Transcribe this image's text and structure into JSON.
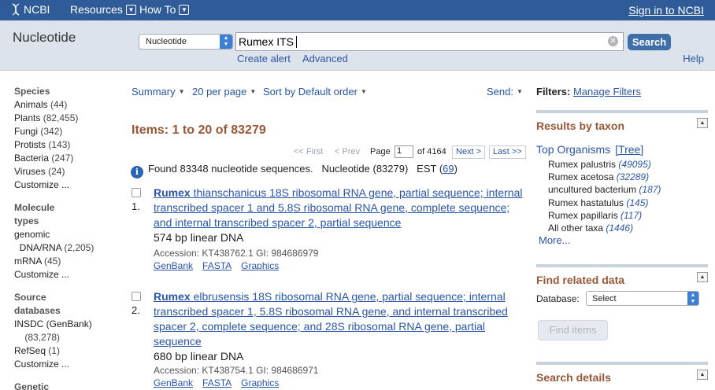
{
  "topbar": {
    "logo": "NCBI",
    "resources": "Resources",
    "howto": "How To",
    "signin": "Sign in to NCBI"
  },
  "search": {
    "db_title": "Nucleotide",
    "db_select": "Nucleotide",
    "term": "Rumex ITS",
    "button": "Search",
    "create_alert": "Create alert",
    "advanced": "Advanced",
    "help": "Help"
  },
  "facets": [
    {
      "header": "Species",
      "items": [
        {
          "label": "Animals",
          "count": "(44)"
        },
        {
          "label": "Plants",
          "count": "(82,455)"
        },
        {
          "label": "Fungi",
          "count": "(342)"
        },
        {
          "label": "Protists",
          "count": "(143)"
        },
        {
          "label": "Bacteria",
          "count": "(247)"
        },
        {
          "label": "Viruses",
          "count": "(24)"
        },
        {
          "label": "Customize ...",
          "count": ""
        }
      ]
    },
    {
      "header1": "Molecule",
      "header2": "types",
      "items": [
        {
          "label": "genomic",
          "label2": "DNA/RNA",
          "count": "(2,205)"
        },
        {
          "label": "mRNA",
          "count": "(45)"
        },
        {
          "label": "Customize ...",
          "count": ""
        }
      ]
    },
    {
      "header1": "Source",
      "header2": "databases",
      "items": [
        {
          "label": "INSDC (GenBank)",
          "label2": "",
          "count": "(83,278)"
        },
        {
          "label": "RefSeq",
          "count": "(1)"
        },
        {
          "label": "Customize ...",
          "count": ""
        }
      ]
    },
    {
      "header": "Genetic"
    }
  ],
  "toolbar": {
    "summary": "Summary",
    "per_page": "20 per page",
    "sort": "Sort by Default order",
    "send": "Send:"
  },
  "results_header": "Items: 1 to 20 of 83279",
  "pager": {
    "first": "<< First",
    "prev": "< Prev",
    "page_label": "Page",
    "page_value": "1",
    "of": "of 4164",
    "next": "Next >",
    "last": "Last >>"
  },
  "found": {
    "text": "Found 83348 nucleotide sequences.",
    "nuc": "Nucleotide (83279)",
    "est_label": "EST (",
    "est_count": "69",
    "est_close": ")"
  },
  "results": [
    {
      "num": "1.",
      "title_bold": "Rumex",
      "title_rest": " thianschanicus 18S ribosomal RNA gene, partial sequence; internal transcribed spacer 1 and 5.8S ribosomal RNA gene, complete sequence; and internal transcribed spacer 2, partial sequence",
      "desc": "574 bp linear DNA",
      "accession": "Accession: KT438762.1   GI: 984686979",
      "links": [
        "GenBank",
        "FASTA",
        "Graphics"
      ]
    },
    {
      "num": "2.",
      "title_bold": "Rumex",
      "title_rest": " elbrusensis 18S ribosomal RNA gene, partial sequence; internal transcribed spacer 1, 5.8S ribosomal RNA gene, and internal transcribed spacer 2, complete sequence; and 28S ribosomal RNA gene, partial sequence",
      "desc": "680 bp linear DNA",
      "accession": "Accession: KT438754.1   GI: 984686971",
      "links": [
        "GenBank",
        "FASTA",
        "Graphics"
      ]
    }
  ],
  "filters": {
    "label": "Filters:",
    "manage": "Manage Filters"
  },
  "taxon": {
    "header": "Results by taxon",
    "top_org": "Top Organisms",
    "tree": "[Tree]",
    "orgs": [
      {
        "name": "Rumex palustris",
        "count": "(49095)"
      },
      {
        "name": "Rumex acetosa",
        "count": "(32289)"
      },
      {
        "name": "uncultured bacterium",
        "count": "(187)"
      },
      {
        "name": "Rumex hastatulus",
        "count": "(145)"
      },
      {
        "name": "Rumex papillaris",
        "count": "(117)"
      },
      {
        "name": "All other taxa",
        "count": "(1446)"
      }
    ],
    "more": "More..."
  },
  "related": {
    "header": "Find related data",
    "db_label": "Database:",
    "db_value": "Select",
    "find_button": "Find items"
  },
  "details": {
    "header": "Search details"
  },
  "colors": {
    "topbar": "#2f5c99",
    "link": "#2a55a8",
    "heading_brown": "#985735",
    "search_btn": "#3f6fa8"
  }
}
